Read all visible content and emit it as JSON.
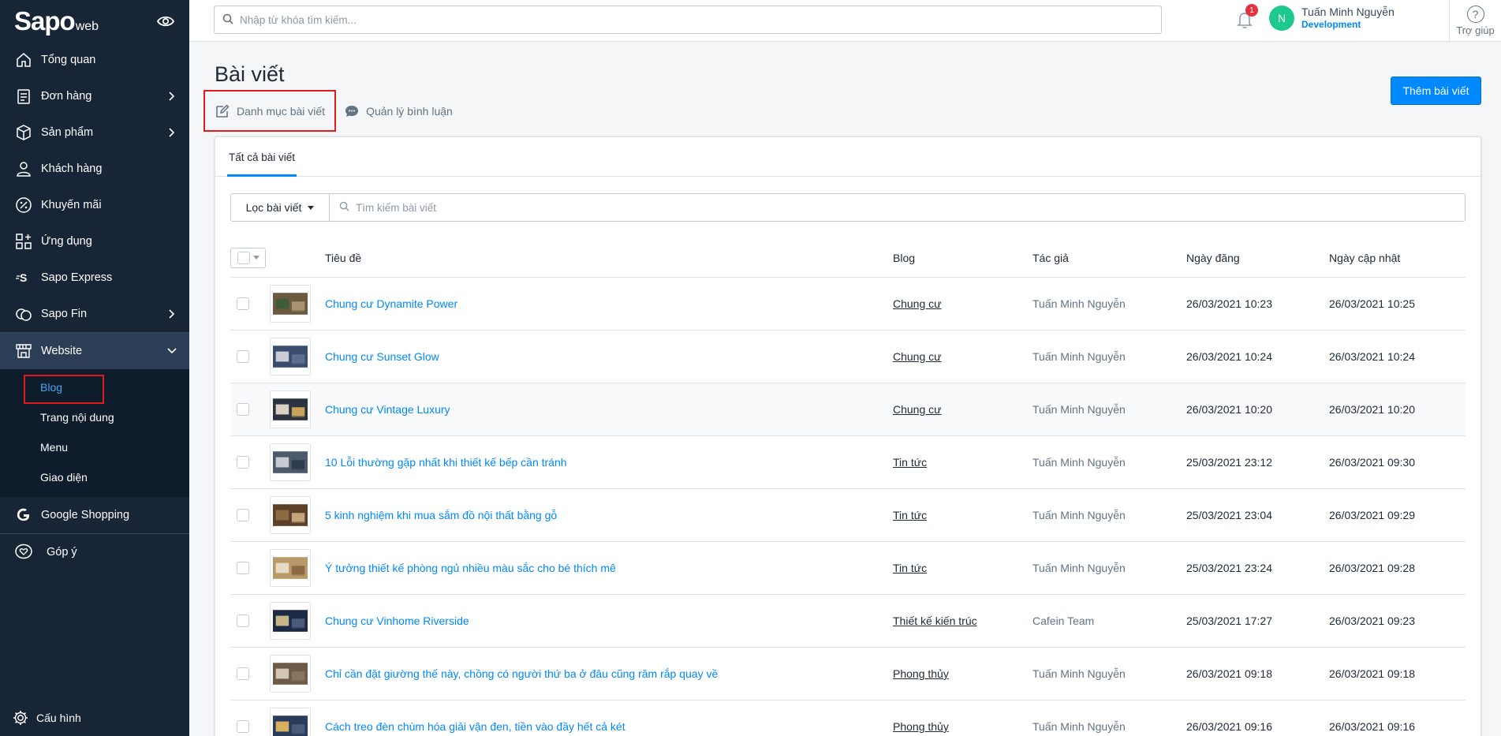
{
  "sidebar": {
    "logo_brand": "Sapo",
    "logo_suffix": "web",
    "items": [
      {
        "label": "Tổng quan"
      },
      {
        "label": "Đơn hàng"
      },
      {
        "label": "Sản phẩm"
      },
      {
        "label": "Khách hàng"
      },
      {
        "label": "Khuyến mãi"
      },
      {
        "label": "Ứng dụng"
      },
      {
        "label": "Sapo Express"
      },
      {
        "label": "Sapo Fin"
      },
      {
        "label": "Website"
      }
    ],
    "website_sub": [
      {
        "label": "Blog"
      },
      {
        "label": "Trang nội dung"
      },
      {
        "label": "Menu"
      },
      {
        "label": "Giao diện"
      }
    ],
    "google_shopping": "Google Shopping",
    "feedback": "Góp ý",
    "settings": "Cấu hình"
  },
  "topbar": {
    "search_placeholder": "Nhập từ khóa tìm kiếm...",
    "notification_count": "1",
    "user_initial": "N",
    "user_name": "Tuấn Minh Nguyễn",
    "user_role": "Development",
    "help_label": "Trợ giúp"
  },
  "page": {
    "title": "Bài viết",
    "add_button": "Thêm bài viết",
    "link_categories": "Danh mục bài viết",
    "link_comments": "Quản lý bình luận",
    "tab_all": "Tất cả bài viết",
    "filter_label": "Lọc bài viết",
    "search_placeholder": "Tìm kiếm bài viết"
  },
  "table": {
    "headers": {
      "title": "Tiêu đề",
      "blog": "Blog",
      "author": "Tác giả",
      "posted": "Ngày đăng",
      "updated": "Ngày cập nhật"
    },
    "rows": [
      {
        "title": "Chung cư Dynamite Power",
        "blog": "Chung cư",
        "author": "Tuấn Minh Nguyễn",
        "posted": "26/03/2021 10:23",
        "updated": "26/03/2021 10:25"
      },
      {
        "title": "Chung cư Sunset Glow",
        "blog": "Chung cư",
        "author": "Tuấn Minh Nguyễn",
        "posted": "26/03/2021 10:24",
        "updated": "26/03/2021 10:24"
      },
      {
        "title": "Chung cư Vintage Luxury",
        "blog": "Chung cư",
        "author": "Tuấn Minh Nguyễn",
        "posted": "26/03/2021 10:20",
        "updated": "26/03/2021 10:20"
      },
      {
        "title": "10 Lỗi thường gặp nhất khi thiết kế bếp cần tránh",
        "blog": "Tin tức",
        "author": "Tuấn Minh Nguyễn",
        "posted": "25/03/2021 23:12",
        "updated": "26/03/2021 09:30"
      },
      {
        "title": "5 kinh nghiệm khi mua sắm đồ nội thất bằng gỗ",
        "blog": "Tin tức",
        "author": "Tuấn Minh Nguyễn",
        "posted": "25/03/2021 23:04",
        "updated": "26/03/2021 09:29"
      },
      {
        "title": "Ý tưởng thiết kế phòng ngủ nhiều màu sắc cho bé thích mê",
        "blog": "Tin tức",
        "author": "Tuấn Minh Nguyễn",
        "posted": "25/03/2021 23:24",
        "updated": "26/03/2021 09:28"
      },
      {
        "title": "Chung cư Vinhome Riverside",
        "blog": "Thiết kế kiến trúc",
        "author": "Cafein Team",
        "posted": "25/03/2021 17:27",
        "updated": "26/03/2021 09:23"
      },
      {
        "title": "Chỉ cần đặt giường thế này, chồng có người thứ ba ở đâu cũng răm rắp quay về",
        "blog": "Phong thủy",
        "author": "Tuấn Minh Nguyễn",
        "posted": "26/03/2021 09:18",
        "updated": "26/03/2021 09:18"
      },
      {
        "title": "Cách treo đèn chùm hóa giải vận đen, tiền vào đầy hết cả két",
        "blog": "Phong thủy",
        "author": "Tuấn Minh Nguyễn",
        "posted": "26/03/2021 09:16",
        "updated": "26/03/2021 09:16"
      }
    ]
  },
  "colors": {
    "sidebar_bg": "#182537",
    "accent": "#0088ff",
    "highlight_box": "#e11a1a",
    "avatar": "#1ec98f"
  }
}
